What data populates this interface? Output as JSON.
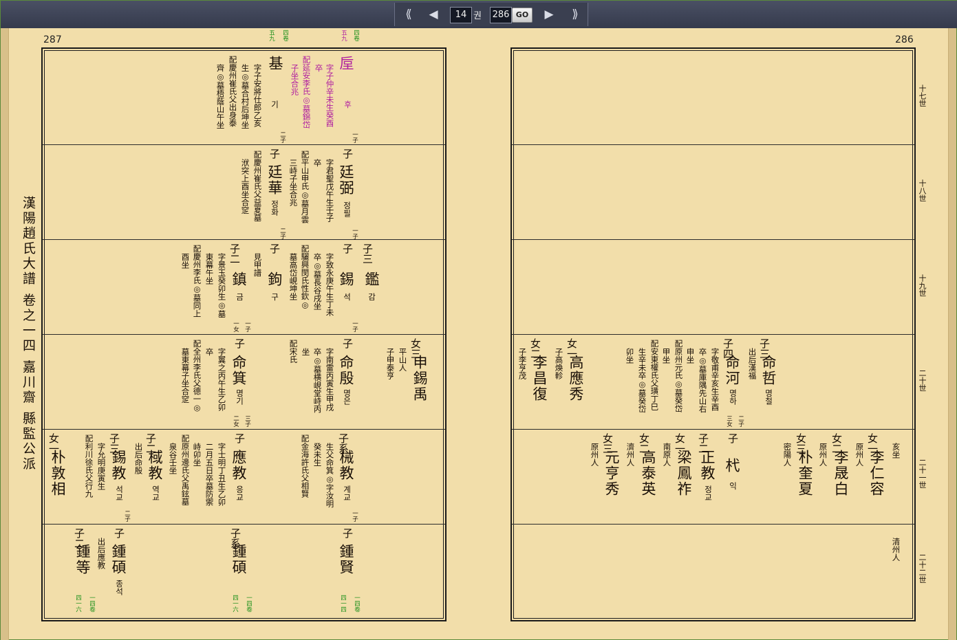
{
  "nav": {
    "first_icon": "double-left-icon",
    "prev_icon": "left-arrow-icon",
    "volume": "14",
    "volume_unit": "권",
    "page": "286",
    "go_label": "GO",
    "next_icon": "right-arrow-icon",
    "last_icon": "double-right-icon"
  },
  "left_page_number": "287",
  "right_page_number": "286",
  "side_title": "漢陽趙氏大譜 卷之一四 嘉川齋 縣監公派",
  "generations": [
    "十七世",
    "十八世",
    "十九世",
    "二十世",
    "二十一世",
    "二十二世"
  ],
  "left": {
    "r1": {
      "ref_a": "四卷",
      "ref_b": "五九",
      "ref_c": "四卷",
      "ref_d": "五九",
      "p1_name": "垕",
      "p1_kr": "후",
      "p1_rank": "一子",
      "p1_info1": "字子仲辛未生癸酉",
      "p1_info2": "卒",
      "p1_info3": "配延安李氏◎墓錦岱",
      "p1_info4": "子坐合兆",
      "p2_name": "基",
      "p2_kr": "기",
      "p2_rank": "二子",
      "p2_info1": "字子安將仕郎乙亥",
      "p2_info2": "生◎墓合村后坤坐",
      "p2_info3": "配慶州崔氏父出身泰",
      "p2_info4": "齊◎墓梧蔭山午坐"
    },
    "r2": {
      "p1_tag": "子",
      "p1_name": "廷弼",
      "p1_kr": "정필",
      "p1_rank": "一子",
      "p1_info1": "字君聖戊午生壬子",
      "p1_info2": "卒",
      "p1_info3": "配平山申氏◎墓月雲",
      "p1_info4": "三峙子坐合兆",
      "p2_tag": "子",
      "p2_name": "廷華",
      "p2_kr": "정화",
      "p2_rank": "二子",
      "p2_info1": "配慶州崔氏父益夏墓",
      "p2_info2": "洑突上酉坐合窆"
    },
    "r3": {
      "p0_tag": "子三",
      "p0_name": "鑑",
      "p0_kr": "감",
      "p1_tag": "子",
      "p1_name": "錫",
      "p1_kr": "석",
      "p1_rank": "一子",
      "p1_info1": "字致永庚午生丁未",
      "p1_info2": "卒◎墓長谷戌坐",
      "p1_info3": "配驪興閔氏性欽◎",
      "p1_info4": "墓高岱峴坤坐",
      "p2_tag": "子",
      "p2_name": "鉤",
      "p2_kr": "구",
      "p2_note": "見甲譜",
      "p3_tag": "子二",
      "p3_name": "鎮",
      "p3_kr": "금",
      "p3_rank": "一子",
      "p3_rank2": "一女",
      "p3_info1": "字景玉癸卯生◎墓",
      "p3_info2": "東幕午坐",
      "p3_info3": "配慶州李氏◎墓同上",
      "p3_info4": "酉坐"
    },
    "r4": {
      "p0_tag": "女三",
      "p0_name": "申錫禹",
      "p0_info1": "平山人",
      "p0_info2": "子申泰亨",
      "p1_tag": "子",
      "p1_name": "命殷",
      "p1_kr": "명은",
      "p1_info1": "字南雷丙寅生甲戌",
      "p1_info2": "卒◎墓横峴堂峙丙",
      "p1_info3": "坐",
      "p1_info4": "配宋氏",
      "p2_tag": "子",
      "p2_name": "命箕",
      "p2_kr": "명기",
      "p2_rank": "三子",
      "p2_rank2": "二女",
      "p2_info1": "字翼之丙午生乙卯",
      "p2_info2": "卒",
      "p2_info3": "配全州李氏父德一◎",
      "p2_info4": "墓東幕子坐合窆"
    },
    "r5": {
      "p1_tag": "子系",
      "p1_name": "械教",
      "p1_kr": "계교",
      "p1_rank": "一子",
      "p1_info1": "生父命箕◎字汝明",
      "p1_info2": "癸未生",
      "p1_info3": "配金海許氏父相賢",
      "p2_tag": "子",
      "p2_name": "應教",
      "p2_kr": "응교",
      "p2_info1": "字士明丁丑生乙卯",
      "p2_info2": "二月五日卒墓防禦",
      "p2_info3": "峙卯坐",
      "p2_info4": "配原州邊氏父禹鉉墓",
      "p2_info5": "泉谷壬坐",
      "p3_tag": "子二",
      "p3_name": "棫教",
      "p3_kr": "역교",
      "p3_info1": "出后命殷",
      "p4_tag": "子三",
      "p4_name": "錫教",
      "p4_kr": "석교",
      "p4_rank": "二子",
      "p4_info1": "字允明庚寅生",
      "p4_info2": "配利川徐氏父行九",
      "p5_tag": "女一",
      "p5_name": "朴敦相"
    },
    "r6": {
      "p1_tag": "子",
      "p1_name": "鍾賢",
      "p1_ref_a": "一四卷",
      "p1_ref_b": "四一四",
      "p2_tag": "子系",
      "p2_name": "鍾碩",
      "p2_ref_a": "一四卷",
      "p2_ref_b": "四一六",
      "p3_tag": "子",
      "p3_name": "鍾碩",
      "p3_kr": "종석",
      "p3_ref_a": "一四卷",
      "p3_ref_b": "四一六",
      "p4_tag": "子二",
      "p4_name": "鍾等",
      "p4_info1": "出后應教"
    }
  },
  "right": {
    "r4": {
      "p1_tag": "子三",
      "p1_name": "命哲",
      "p1_kr": "명철",
      "p1_info1": "出后漢福",
      "p2_tag": "子四",
      "p2_name": "命河",
      "p2_kr": "명하",
      "p2_rank": "二子",
      "p2_rank2": "三女",
      "p2_info1": "字敬甫辛亥生辛酉",
      "p2_info2": "卒◎墓庫隅先山右",
      "p2_info3": "申坐",
      "p2_info4": "配原州元氏◎墓癸岱",
      "p2_info5": "甲坐",
      "p2_info6": "配安東權氏父璜丁巳",
      "p2_info7": "生辛未卒◎墓癸岱",
      "p2_info8": "卯坐",
      "p3_tag": "女一",
      "p3_name": "高應秀",
      "p3_info1": "子高煥軫",
      "p4_tag": "女二",
      "p4_name": "李昌復",
      "p4_info1": "子李亨茂"
    },
    "r5": {
      "p1_note": "亥坐",
      "p1_tag": "女一",
      "p1_name": "李仁容",
      "p1_info1": "原州人",
      "p2_tag": "女二",
      "p2_name": "李晟白",
      "p2_info1": "原州人",
      "p3_tag": "女三",
      "p3_name": "朴奎夏",
      "p3_info1": "密陽人",
      "p4_tag": "子",
      "p4_name": "杙",
      "p4_kr": "익",
      "p5_tag": "子二",
      "p5_name": "正教",
      "p5_kr": "정교",
      "p6_tag": "女一",
      "p6_name": "梁鳳祚",
      "p6_info1": "南原人",
      "p7_tag": "女二",
      "p7_name": "高泰英",
      "p7_info1": "濟州人",
      "p8_tag": "女三",
      "p8_name": "元亨秀",
      "p8_info1": "原州人"
    },
    "r6": {
      "note": "清州人"
    }
  },
  "colors": {
    "toolbar": "#3a3f50",
    "paper": "#f2deaa",
    "pink": "#b01fa0",
    "green": "#1a8f1a"
  }
}
